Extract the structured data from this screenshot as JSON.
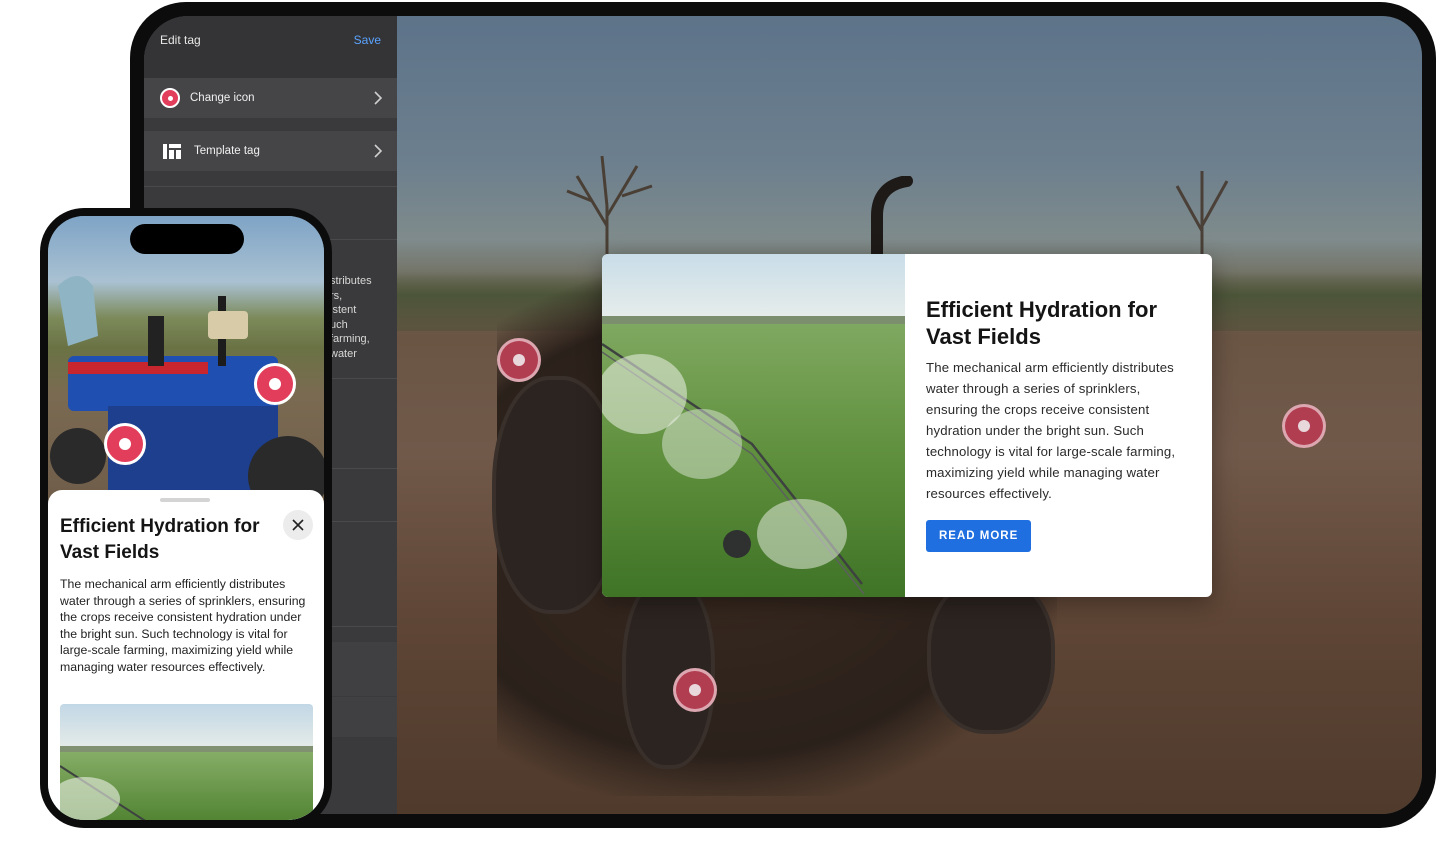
{
  "sidebar": {
    "title": "Edit tag",
    "save_label": "Save",
    "change_icon_label": "Change icon",
    "template_tag_label": "Template tag",
    "obscured_text": [
      "stributes",
      "rs,",
      "istent",
      "uch",
      "farming,",
      "water"
    ]
  },
  "popup": {
    "title": "Efficient Hydration for Vast Fields",
    "body": "The mechanical arm efficiently distributes water through a series of sprinklers, ensuring the crops receive consistent hydration under the bright sun. Such technology is vital for large-scale farming, maximizing yield while managing water resources effectively.",
    "button_label": "READ MORE"
  },
  "phone_sheet": {
    "title": "Efficient Hydration for Vast Fields",
    "body": "The mechanical arm efficiently distributes water through a series of sprinklers, ensuring the crops receive consistent hydration under the bright sun. Such technology is vital for large-scale farming, maximizing yield while managing water resources effectively."
  },
  "colors": {
    "accent_blue": "#1f6fe0",
    "link_blue": "#5aa3ff",
    "tag_red": "#e23d5b",
    "sidebar_bg": "#3a3a3c"
  },
  "icons": {
    "change_icon": "red-dot-icon",
    "template_tag": "template-grid-icon",
    "row_chevron": "chevron-right-icon",
    "close": "close-icon"
  }
}
